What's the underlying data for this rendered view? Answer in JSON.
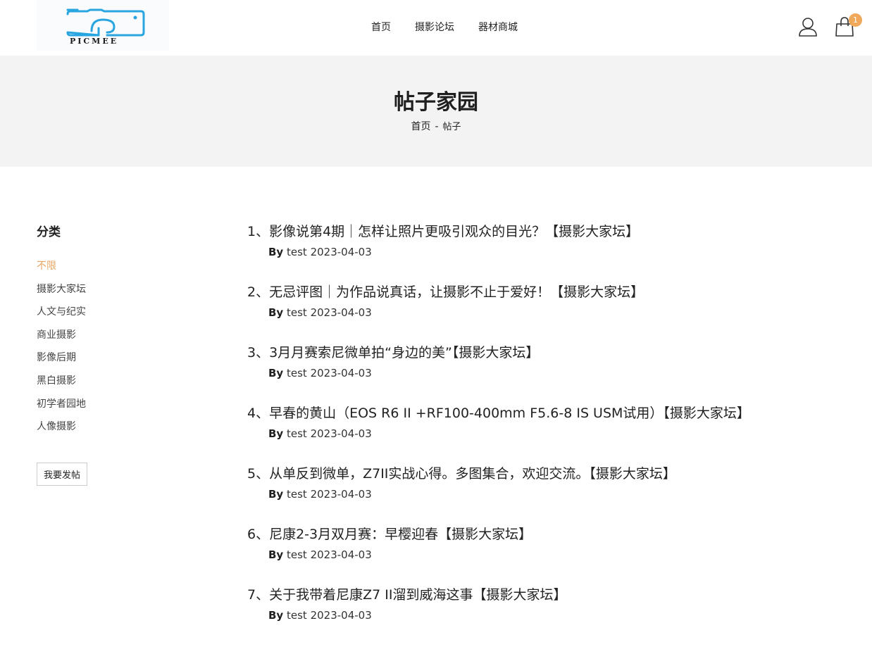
{
  "header": {
    "logo_text": "PICMEE",
    "nav": [
      "首页",
      "摄影论坛",
      "器材商城"
    ],
    "icons": {
      "account": "user-icon",
      "cart": "shopping-bag-icon"
    },
    "cart_count": "1",
    "badge_color": "#f0a95a",
    "logo_color": "#29a6e0"
  },
  "banner": {
    "title": "帖子家园",
    "breadcrumb": {
      "home": "首页",
      "separator": "-",
      "current": "帖子"
    }
  },
  "sidebar": {
    "title": "分类",
    "categories": [
      "不限",
      "摄影大家坛",
      "人文与纪实",
      "商业摄影",
      "影像后期",
      "黑白摄影",
      "初学者园地",
      "人像摄影"
    ],
    "active_index": 0,
    "active_color": "#e8a561",
    "post_button": "我要发帖"
  },
  "posts": [
    {
      "title": "1、影像说第4期｜怎样让照片更吸引观众的目光？【摄影大家坛】",
      "by": "By",
      "author": "test",
      "date": "2023-04-03"
    },
    {
      "title": "2、无忌评图｜为作品说真话，让摄影不止于爱好！【摄影大家坛】",
      "by": "By",
      "author": "test",
      "date": "2023-04-03"
    },
    {
      "title": "3、3月月赛索尼微单拍“身边的美”【摄影大家坛】",
      "by": "By",
      "author": "test",
      "date": "2023-04-03"
    },
    {
      "title": "4、早春的黄山（EOS R6 II +RF100-400mm F5.6-8 IS USM试用）【摄影大家坛】",
      "by": "By",
      "author": "test",
      "date": "2023-04-03"
    },
    {
      "title": "5、从单反到微单，Z7II实战心得。多图集合，欢迎交流。【摄影大家坛】",
      "by": "By",
      "author": "test",
      "date": "2023-04-03"
    },
    {
      "title": "6、尼康2-3月双月赛：早樱迎春【摄影大家坛】",
      "by": "By",
      "author": "test",
      "date": "2023-04-03"
    },
    {
      "title": "7、关于我带着尼康Z7 II溜到威海这事【摄影大家坛】",
      "by": "By",
      "author": "test",
      "date": "2023-04-03"
    }
  ]
}
